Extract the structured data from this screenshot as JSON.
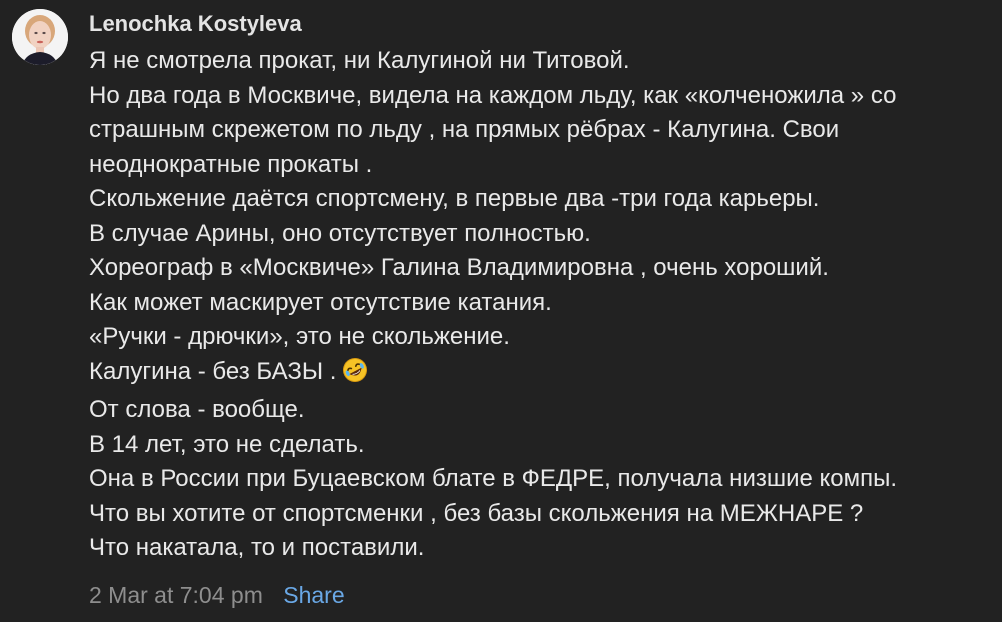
{
  "comment": {
    "author": "Lenochka Kostyleva",
    "avatar_icon": "person-avatar-icon",
    "lines": [
      "Я не смотрела прокат, ни Калугиной ни Титовой.",
      "Но два года в Москвиче, видела на каждом льду, как «колченожила » со",
      "страшным скрежетом по льду , на прямых рёбрах - Калугина. Свои",
      "неоднократные прокаты .",
      "Скольжение даётся спортсмену, в первые два -три года карьеры.",
      "В случае Арины, оно отсутствует полностью.",
      "Хореограф в «Москвиче» Галина Владимировна , очень хороший.",
      "Как может маскирует отсутствие катания.",
      "«Ручки - дрючки», это не скольжение.",
      "Калугина - без БАЗЫ .",
      "От слова - вообще.",
      "В 14 лет, это не сделать.",
      "Она в России при Буцаевском блате в ФЕДРЕ, получала низшие компы.",
      "Что вы хотите от спортсменки , без базы скольжения на МЕЖНАРЕ ?",
      "Что накатала, то и поставили."
    ],
    "emoji_icon": "rolling-on-floor-laughing-emoji-icon",
    "timestamp": "2 Mar at 7:04 pm",
    "share_label": "Share"
  },
  "colors": {
    "background": "#222222",
    "text": "#e9e9e9",
    "timestamp": "#8e8e8e",
    "share_link": "#6aa8e6"
  }
}
